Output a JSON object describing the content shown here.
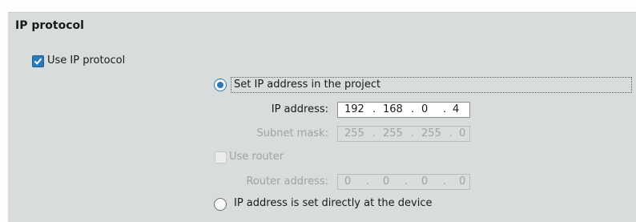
{
  "section": {
    "title": "IP protocol"
  },
  "use_ip_protocol": {
    "label": "Use IP protocol",
    "checked": true
  },
  "set_in_project": {
    "label": "Set IP address in the project",
    "selected": true
  },
  "ip_address": {
    "label": "IP address:",
    "octets": [
      "192",
      "168",
      "0",
      "4"
    ],
    "separator": "."
  },
  "subnet_mask": {
    "label": "Subnet mask:",
    "octets": [
      "255",
      "255",
      "255",
      "0"
    ],
    "separator": "."
  },
  "use_router": {
    "label": "Use router",
    "checked": false
  },
  "router_address": {
    "label": "Router address:",
    "octets": [
      "0",
      "0",
      "0",
      "0"
    ],
    "separator": "."
  },
  "set_at_device": {
    "label": "IP address is set directly at the device",
    "selected": false
  },
  "colors": {
    "accent": "#2c7bb8",
    "panel": "#d9dcdc",
    "disabled_text": "#9ea3a4"
  }
}
